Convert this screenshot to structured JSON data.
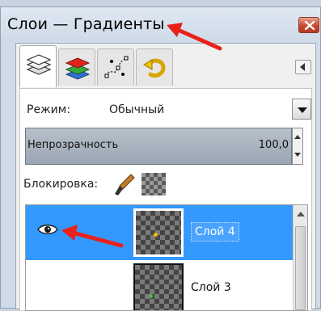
{
  "window": {
    "title": "Слои — Градиенты"
  },
  "tabs": [
    {
      "icon": "layers-icon",
      "active": true
    },
    {
      "icon": "channels-icon",
      "active": false
    },
    {
      "icon": "paths-icon",
      "active": false
    },
    {
      "icon": "undo-history-icon",
      "active": false
    }
  ],
  "toolbar": {
    "mode_label": "Режим:",
    "mode_value": "Обычный",
    "opacity_label": "Непрозрачность",
    "opacity_value": "100,0",
    "lock_label": "Блокировка:"
  },
  "layers": [
    {
      "name": "Слой 4",
      "visible": true,
      "selected": true
    },
    {
      "name": "Слой 3",
      "visible": false,
      "selected": false
    }
  ],
  "colors": {
    "selection": "#3399ff",
    "annotation_arrow": "#e8221a",
    "close_button": "#c8462f"
  }
}
